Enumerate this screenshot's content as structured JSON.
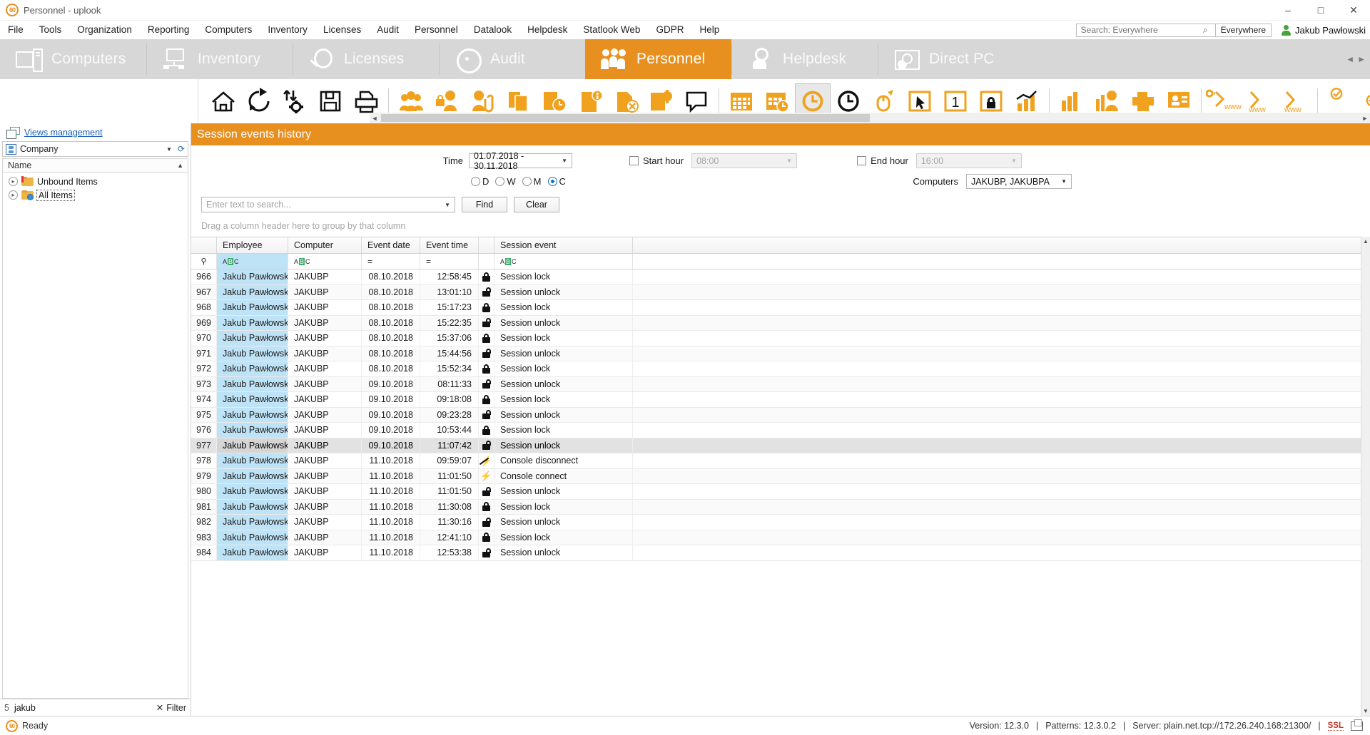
{
  "window": {
    "title": "Personnel - uplook",
    "logo_text": "60",
    "minimize": "–",
    "maximize": "□",
    "close": "✕"
  },
  "menu": {
    "items": [
      "File",
      "Tools",
      "Organization",
      "Reporting",
      "Computers",
      "Inventory",
      "Licenses",
      "Audit",
      "Personnel",
      "Datalook",
      "Helpdesk",
      "Statlook Web",
      "GDPR",
      "Help"
    ],
    "search_placeholder": "Search: Everywhere",
    "search_icon": "search-icon",
    "scope_button": "Everywhere",
    "user_name": "Jakub Pawłowski"
  },
  "ribbon": {
    "tabs": [
      {
        "label": "Computers",
        "icon": "computers-icon",
        "active": false
      },
      {
        "label": "Inventory",
        "icon": "inventory-icon",
        "active": false
      },
      {
        "label": "Licenses",
        "icon": "licenses-icon",
        "active": false
      },
      {
        "label": "Audit",
        "icon": "audit-icon",
        "active": false
      },
      {
        "label": "Personnel",
        "icon": "personnel-icon",
        "active": true
      },
      {
        "label": "Helpdesk",
        "icon": "helpdesk-icon",
        "active": false
      },
      {
        "label": "Direct PC",
        "icon": "direct-pc-icon",
        "active": false
      }
    ],
    "nav_prev": "◄",
    "nav_next": "►"
  },
  "toolbar": {
    "scroll_left": "◄",
    "scroll_right": "►",
    "buttons": [
      "home-icon",
      "refresh-icon",
      "sync-settings-icon",
      "save-icon",
      "print-icon",
      "group-people-icon",
      "locked-user-icon",
      "user-attachment-icon",
      "documents-icon",
      "history-docs-icon",
      "report-info-icon",
      "user-remove-icon",
      "settings-user-icon",
      "comment-icon",
      "calendar-icon",
      "calendar-clock-icon",
      "clock-active-icon",
      "clock-icon",
      "mouse-activity-icon",
      "cursor-icon",
      "one-icon",
      "lock-report-icon",
      "bar-chart-icon",
      "statistics-icon",
      "user-stats-icon",
      "printer-report-icon",
      "presentation-icon",
      "www-key-icon",
      "www-icon",
      "www-block-icon",
      "check-icon",
      "plus-icon"
    ]
  },
  "sidebar": {
    "views_management": "Views management",
    "views_icon": "views-icon",
    "company_label": "Company",
    "company_icon": "company-icon",
    "refresh_icon": "refresh-icon",
    "column_header": "Name",
    "sort_arrow": "▲",
    "tree": [
      {
        "label": "Unbound Items",
        "icon": "folder-flag-icon",
        "selected": false
      },
      {
        "label": "All Items",
        "icon": "folder-globe-icon",
        "selected": true
      }
    ],
    "footer": {
      "count": "5",
      "value": "jakub",
      "filter_label": "Filter",
      "filter_icon": "clear-filter-icon"
    }
  },
  "panel": {
    "title": "Session events history",
    "time_label": "Time",
    "time_value": "01.07.2018 - 30.11.2018",
    "period_options": [
      {
        "label": "D",
        "selected": false
      },
      {
        "label": "W",
        "selected": false
      },
      {
        "label": "M",
        "selected": false
      },
      {
        "label": "C",
        "selected": true
      }
    ],
    "start_hour_label": "Start hour",
    "start_hour_value": "08:00",
    "start_hour_checked": false,
    "end_hour_label": "End hour",
    "end_hour_value": "16:00",
    "end_hour_checked": false,
    "computers_label": "Computers",
    "computers_value": "JAKUBP, JAKUBPA",
    "search_placeholder": "Enter text to search...",
    "find_button": "Find",
    "clear_button": "Clear",
    "group_hint": "Drag a column header here to group by that column"
  },
  "grid": {
    "columns": [
      "",
      "Employee",
      "Computer",
      "Event date",
      "Event time",
      "",
      "Session event",
      ""
    ],
    "filter_row": {
      "pin_icon": "filter-pin-icon",
      "employee": "abc",
      "computer": "abc",
      "event_date": "=",
      "event_time": "=",
      "session_event": "abc"
    },
    "rows": [
      {
        "id": "966",
        "employee": "Jakub Pawłowski",
        "computer": "JAKUBP",
        "date": "08.10.2018",
        "time": "12:58:45",
        "icon": "lock-icon",
        "event": "Session lock",
        "current": false
      },
      {
        "id": "967",
        "employee": "Jakub Pawłowski",
        "computer": "JAKUBP",
        "date": "08.10.2018",
        "time": "13:01:10",
        "icon": "unlock-icon",
        "event": "Session unlock",
        "current": false
      },
      {
        "id": "968",
        "employee": "Jakub Pawłowski",
        "computer": "JAKUBP",
        "date": "08.10.2018",
        "time": "15:17:23",
        "icon": "lock-icon",
        "event": "Session lock",
        "current": false
      },
      {
        "id": "969",
        "employee": "Jakub Pawłowski",
        "computer": "JAKUBP",
        "date": "08.10.2018",
        "time": "15:22:35",
        "icon": "unlock-icon",
        "event": "Session unlock",
        "current": false
      },
      {
        "id": "970",
        "employee": "Jakub Pawłowski",
        "computer": "JAKUBP",
        "date": "08.10.2018",
        "time": "15:37:06",
        "icon": "lock-icon",
        "event": "Session lock",
        "current": false
      },
      {
        "id": "971",
        "employee": "Jakub Pawłowski",
        "computer": "JAKUBP",
        "date": "08.10.2018",
        "time": "15:44:56",
        "icon": "unlock-icon",
        "event": "Session unlock",
        "current": false
      },
      {
        "id": "972",
        "employee": "Jakub Pawłowski",
        "computer": "JAKUBP",
        "date": "08.10.2018",
        "time": "15:52:34",
        "icon": "lock-icon",
        "event": "Session lock",
        "current": false
      },
      {
        "id": "973",
        "employee": "Jakub Pawłowski",
        "computer": "JAKUBP",
        "date": "09.10.2018",
        "time": "08:11:33",
        "icon": "unlock-icon",
        "event": "Session unlock",
        "current": false
      },
      {
        "id": "974",
        "employee": "Jakub Pawłowski",
        "computer": "JAKUBP",
        "date": "09.10.2018",
        "time": "09:18:08",
        "icon": "lock-icon",
        "event": "Session lock",
        "current": false
      },
      {
        "id": "975",
        "employee": "Jakub Pawłowski",
        "computer": "JAKUBP",
        "date": "09.10.2018",
        "time": "09:23:28",
        "icon": "unlock-icon",
        "event": "Session unlock",
        "current": false
      },
      {
        "id": "976",
        "employee": "Jakub Pawłowski",
        "computer": "JAKUBP",
        "date": "09.10.2018",
        "time": "10:53:44",
        "icon": "lock-icon",
        "event": "Session lock",
        "current": false
      },
      {
        "id": "977",
        "employee": "Jakub Pawłowski",
        "computer": "JAKUBP",
        "date": "09.10.2018",
        "time": "11:07:42",
        "icon": "unlock-icon",
        "event": "Session unlock",
        "current": true
      },
      {
        "id": "978",
        "employee": "Jakub Pawłowski",
        "computer": "JAKUBP",
        "date": "11.10.2018",
        "time": "09:59:07",
        "icon": "console-disconnect-icon",
        "event": "Console disconnect",
        "current": false
      },
      {
        "id": "979",
        "employee": "Jakub Pawłowski",
        "computer": "JAKUBP",
        "date": "11.10.2018",
        "time": "11:01:50",
        "icon": "console-connect-icon",
        "event": "Console connect",
        "current": false
      },
      {
        "id": "980",
        "employee": "Jakub Pawłowski",
        "computer": "JAKUBP",
        "date": "11.10.2018",
        "time": "11:01:50",
        "icon": "unlock-icon",
        "event": "Session unlock",
        "current": false
      },
      {
        "id": "981",
        "employee": "Jakub Pawłowski",
        "computer": "JAKUBP",
        "date": "11.10.2018",
        "time": "11:30:08",
        "icon": "lock-icon",
        "event": "Session lock",
        "current": false
      },
      {
        "id": "982",
        "employee": "Jakub Pawłowski",
        "computer": "JAKUBP",
        "date": "11.10.2018",
        "time": "11:30:16",
        "icon": "unlock-icon",
        "event": "Session unlock",
        "current": false
      },
      {
        "id": "983",
        "employee": "Jakub Pawłowski",
        "computer": "JAKUBP",
        "date": "11.10.2018",
        "time": "12:41:10",
        "icon": "lock-icon",
        "event": "Session lock",
        "current": false
      },
      {
        "id": "984",
        "employee": "Jakub Pawłowski",
        "computer": "JAKUBP",
        "date": "11.10.2018",
        "time": "12:53:38",
        "icon": "unlock-icon",
        "event": "Session unlock",
        "current": false
      }
    ]
  },
  "status": {
    "ready": "Ready",
    "version": "Version: 12.3.0",
    "sep1": "|",
    "patterns": "Patterns: 12.3.0.2",
    "sep2": "|",
    "server": "Server: plain.net.tcp://172.26.240.168:21300/",
    "sep3": "|",
    "ssl": "SSL",
    "screen_icon": "remote-screen-icon"
  },
  "colors": {
    "accent": "#e8901f",
    "selection": "#bfe3f6",
    "link": "#1a5fb4"
  }
}
